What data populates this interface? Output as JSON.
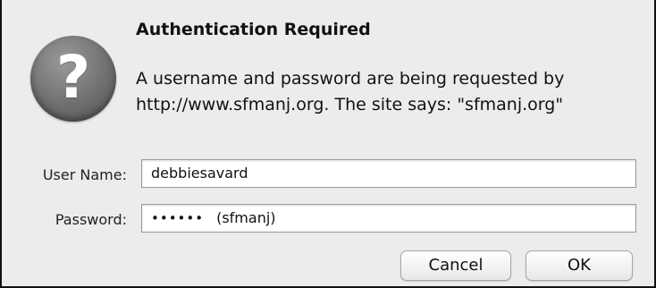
{
  "dialog": {
    "title": "Authentication Required",
    "icon": "question-mark-icon",
    "message_line1": "A username and password are being requested by",
    "message_line2": "http://www.sfmanj.org. The site says: \"sfmanj.org\""
  },
  "form": {
    "username_label": "User Name:",
    "username_value": "debbiesavard",
    "password_label": "Password:",
    "password_dots": "••••••",
    "password_hint": "(sfmanj)"
  },
  "buttons": {
    "cancel": "Cancel",
    "ok": "OK"
  }
}
